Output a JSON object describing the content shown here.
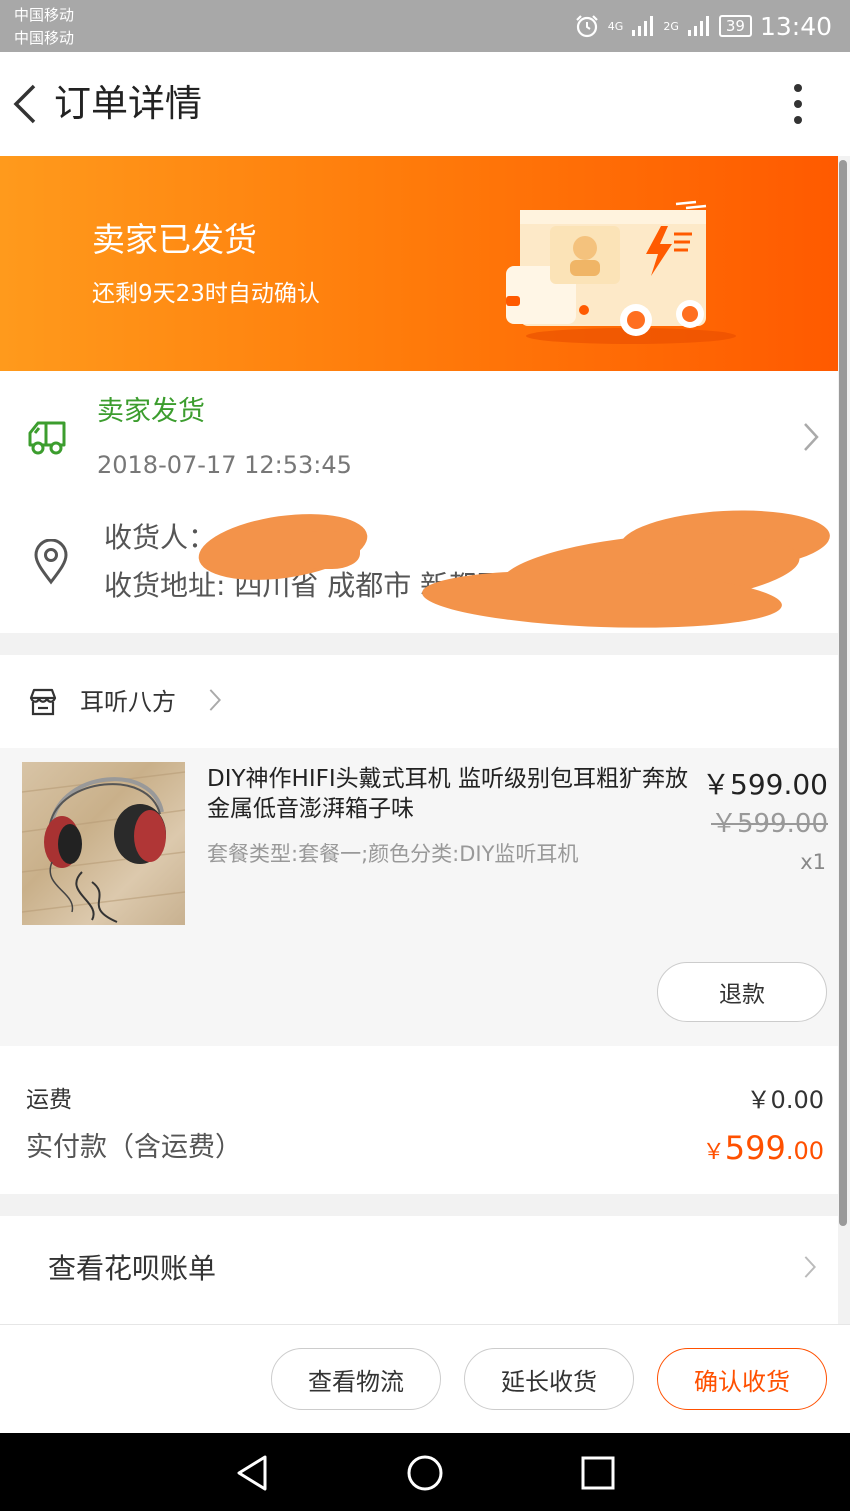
{
  "status_bar": {
    "carrier_1": "中国移动",
    "carrier_2": "中国移动",
    "signal_1": "4G",
    "signal_2": "2G",
    "battery": "39",
    "time": "13:40",
    "icons": [
      "alarm-icon",
      "signal-icon",
      "battery-icon"
    ]
  },
  "header": {
    "title": "订单详情",
    "back_icon": "chevron-left-icon",
    "more_icon": "more-vertical-icon"
  },
  "banner": {
    "title": "卖家已发货",
    "subtitle": "还剩9天23时自动确认",
    "illustration": "delivery-truck-illustration",
    "colors": {
      "start": "#ff9a1c",
      "end": "#ff5a00"
    }
  },
  "logistics": {
    "status": "卖家发货",
    "time": "2018-07-17 12:53:45",
    "status_color": "#3c9d2e"
  },
  "receiver": {
    "name_label": "收货人：",
    "address_label": "收货地址: 四川省 成都市 新都区"
  },
  "shop": {
    "name": "耳听八方",
    "icon": "shop-icon"
  },
  "product": {
    "title": "DIY神作HIFI头戴式耳机 监听级别包耳粗犷奔放金属低音澎湃箱子味",
    "spec": "套餐类型:套餐一;颜色分类:DIY监听耳机",
    "price": "￥599.00",
    "original_price": "￥599.00",
    "quantity": "x1",
    "refund_label": "退款"
  },
  "fees": {
    "shipping_label": "运费",
    "shipping_value": "￥0.00",
    "paid_label": "实付款（含运费）",
    "paid_currency": "￥",
    "paid_integer": "599",
    "paid_decimal": ".00",
    "accent_color": "#ff5000"
  },
  "huabei": {
    "label": "查看花呗账单"
  },
  "actions": {
    "logistics": "查看物流",
    "extend": "延长收货",
    "confirm": "确认收货"
  },
  "navigation": {
    "icons": [
      "back-triangle-icon",
      "home-circle-icon",
      "recents-square-icon"
    ]
  }
}
